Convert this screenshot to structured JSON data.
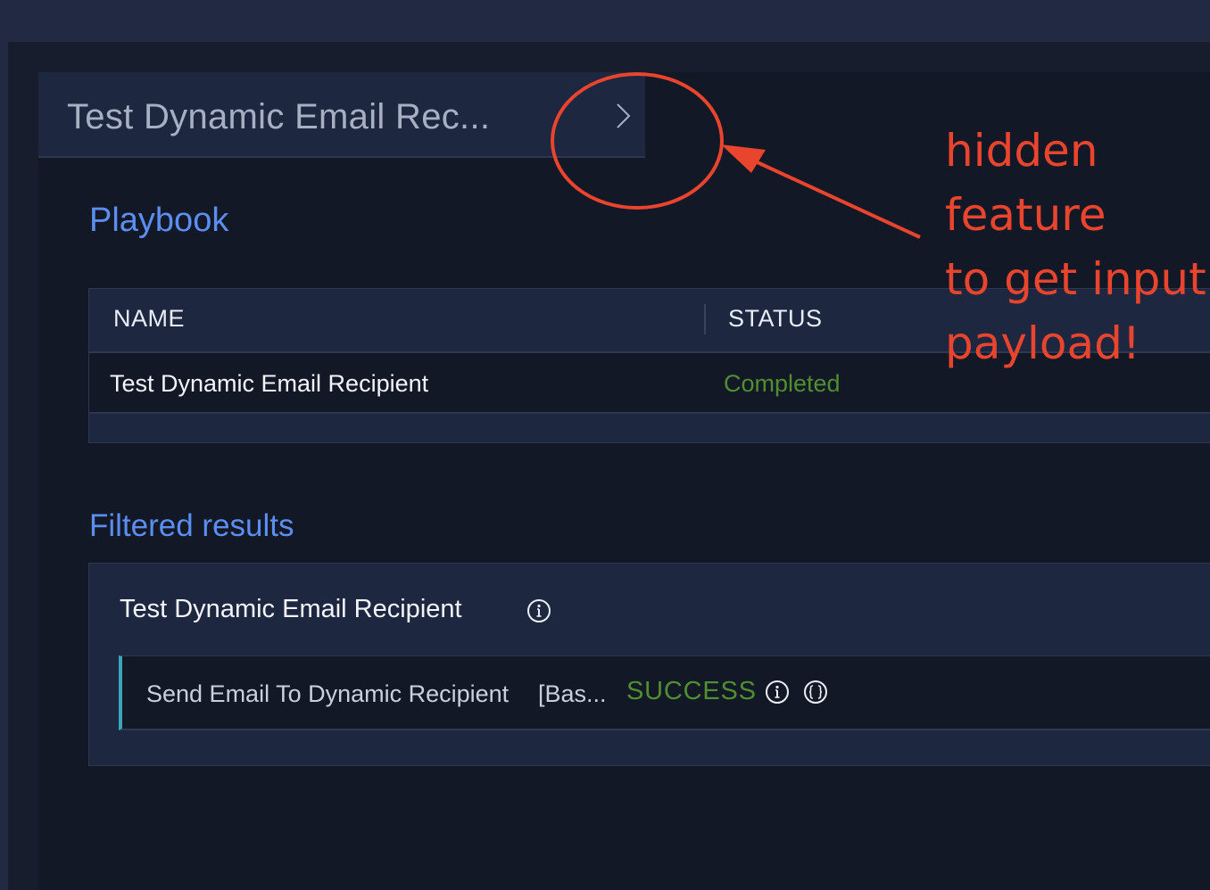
{
  "header": {
    "title": "Test Dynamic Email Rec..."
  },
  "playbook": {
    "heading": "Playbook",
    "columns": [
      "NAME",
      "STATUS"
    ],
    "rows": [
      {
        "name": "Test Dynamic Email Recipient",
        "status": "Completed"
      }
    ]
  },
  "filtered_results": {
    "heading": "Filtered results",
    "group_title": "Test Dynamic Email Recipient",
    "items": [
      {
        "name": "Send Email To Dynamic Recipient",
        "extra": "[Bas...",
        "status": "SUCCESS"
      }
    ]
  },
  "annotation": {
    "lines": [
      "hidden",
      "feature",
      "to get input",
      "payload!"
    ],
    "color": "#e8442e"
  },
  "colors": {
    "accent": "#5b8ef0",
    "status_completed": "#4f8f2f",
    "status_success": "#4f8f2f",
    "row_marker": "#3aa5ba"
  },
  "icons": {
    "expand": "chevron-right-icon",
    "info": "info-circle-icon",
    "payload": "braces-circle-icon"
  }
}
